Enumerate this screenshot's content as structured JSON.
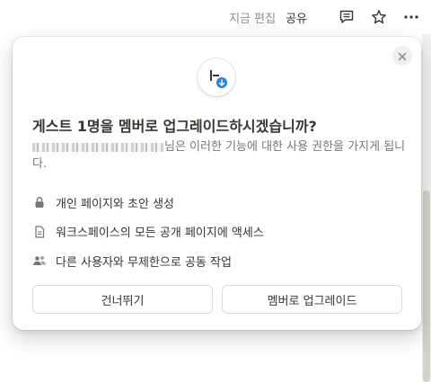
{
  "topbar": {
    "edited": "지금 편집",
    "share": "공유",
    "icons": [
      "comment-icon",
      "star-icon",
      "more-icon"
    ]
  },
  "modal": {
    "title": "게스트 1명을 멤버로 업그레이드하시겠습니까?",
    "description_suffix": "님은 이러한 기능에 대한 사용 권한을 가지게 됩니다.",
    "features": [
      {
        "icon": "lock-icon",
        "label": "개인 페이지와 초안 생성"
      },
      {
        "icon": "document-icon",
        "label": "워크스페이스의 모든 공개 페이지에 액세스"
      },
      {
        "icon": "people-icon",
        "label": "다른 사용자와 무제한으로 공동 작업"
      }
    ],
    "skip_label": "건너뛰기",
    "upgrade_label": "멤버로 업그레이드"
  },
  "colors": {
    "accent": "#2383e2",
    "text": "#37352f",
    "muted": "#787774"
  }
}
